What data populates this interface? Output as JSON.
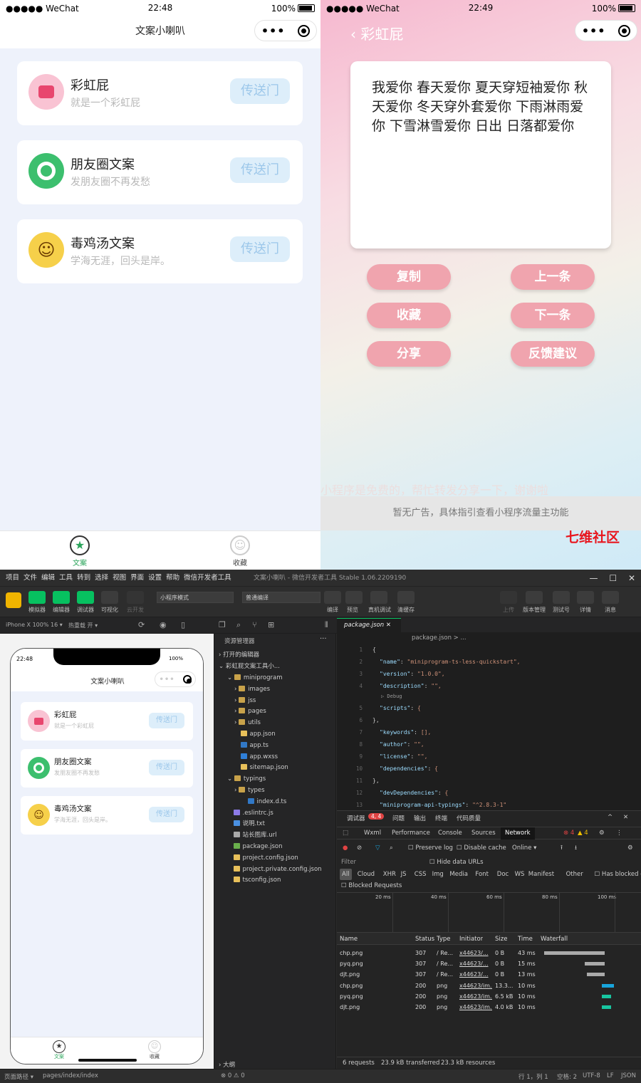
{
  "left_phone": {
    "status": {
      "carrier": "●●●●● WeChat",
      "time": "22:48",
      "battery": "100%"
    },
    "nav_title": "文案小喇叭",
    "cards": [
      {
        "title": "彩虹屁",
        "subtitle": "就是一个彩虹屁",
        "button": "传送门",
        "icon": "heart-icon",
        "color": "#f7a8c0"
      },
      {
        "title": "朋友圈文案",
        "subtitle": "发朋友圈不再发愁",
        "button": "传送门",
        "icon": "shutter-icon",
        "color": "#3cbf6e"
      },
      {
        "title": "毒鸡汤文案",
        "subtitle": "学海无涯，回头是岸。",
        "button": "传送门",
        "icon": "emoji-face-icon",
        "color": "#f6d04a"
      }
    ],
    "tabs": [
      {
        "label": "文案",
        "icon": "star-icon"
      },
      {
        "label": "收藏",
        "icon": "user-icon"
      }
    ]
  },
  "right_phone": {
    "status": {
      "carrier": "●●●●● WeChat",
      "time": "22:49",
      "battery": "100%"
    },
    "back_title": "彩虹屁",
    "content_text": "我爱你 春天爱你 夏天穿短袖爱你 秋天爱你 冬天穿外套爱你 下雨淋雨爱你 下雪淋雪爱你 日出 日落都爱你",
    "buttons": {
      "copy": "复制",
      "prev": "上一条",
      "collect": "收藏",
      "next": "下一条",
      "share": "分享",
      "feedback": "反馈建议"
    },
    "share_note": "小程序是免费的，帮忙转发分享一下，谢谢啦",
    "ad_text": "暂无广告，具体指引查看小程序流量主功能",
    "watermark": "七维社区"
  },
  "ide": {
    "menu": [
      "项目",
      "文件",
      "编辑",
      "工具",
      "转到",
      "选择",
      "视图",
      "界面",
      "设置",
      "帮助",
      "微信开发者工具"
    ],
    "window_title": "文案小喇叭 - 微信开发者工具 Stable 1.06.2209190",
    "toolbar_left": [
      "模拟器",
      "编辑器",
      "调试器",
      "可视化",
      "云开发"
    ],
    "mode_select": "小程序模式",
    "compile_select": "普通编译",
    "toolbar_mid": [
      "编译",
      "预览",
      "真机调试",
      "清缓存"
    ],
    "toolbar_right": [
      "上传",
      "版本管理",
      "测试号",
      "详情",
      "消息"
    ],
    "device": "iPhone X 100% 16 ▾",
    "hot_reload": "热重载 开 ▾",
    "sim": {
      "time": "22:48",
      "battery": "100%",
      "title": "文案小喇叭",
      "cards": [
        {
          "title": "彩虹屁",
          "subtitle": "就是一个彩虹屁",
          "button": "传送门"
        },
        {
          "title": "朋友圈文案",
          "subtitle": "发朋友圈不再发愁",
          "button": "传送门"
        },
        {
          "title": "毒鸡汤文案",
          "subtitle": "学海无涯，回头是岸。",
          "button": "传送门"
        }
      ],
      "tabs": [
        "文案",
        "收藏"
      ]
    },
    "explorer": {
      "title": "资源管理器",
      "open_editors": "打开的编辑器",
      "project": "彩虹屁文案工具小...",
      "tree": [
        {
          "name": "miniprogram",
          "type": "folder-open",
          "indent": 1
        },
        {
          "name": "images",
          "type": "folder",
          "indent": 2
        },
        {
          "name": "jss",
          "type": "folder",
          "indent": 2
        },
        {
          "name": "pages",
          "type": "folder",
          "indent": 2
        },
        {
          "name": "utils",
          "type": "folder",
          "indent": 2
        },
        {
          "name": "app.json",
          "type": "json",
          "indent": 2
        },
        {
          "name": "app.ts",
          "type": "ts",
          "indent": 2
        },
        {
          "name": "app.wxss",
          "type": "wxss",
          "indent": 2
        },
        {
          "name": "sitemap.json",
          "type": "json",
          "indent": 2
        },
        {
          "name": "typings",
          "type": "folder-open",
          "indent": 1
        },
        {
          "name": "types",
          "type": "folder",
          "indent": 2
        },
        {
          "name": "index.d.ts",
          "type": "ts",
          "indent": 3
        },
        {
          "name": ".eslintrc.js",
          "type": "js",
          "indent": 1
        },
        {
          "name": "说明.txt",
          "type": "txt",
          "indent": 1
        },
        {
          "name": "站长图库.url",
          "type": "url",
          "indent": 1
        },
        {
          "name": "package.json",
          "type": "pkg",
          "indent": 1
        },
        {
          "name": "project.config.json",
          "type": "json",
          "indent": 1
        },
        {
          "name": "project.private.config.json",
          "type": "json",
          "indent": 1
        },
        {
          "name": "tsconfig.json",
          "type": "json",
          "indent": 1
        }
      ],
      "outline": "大纲"
    },
    "editor": {
      "tab": "package.json",
      "breadcrumb": "package.json > ...",
      "debug_hint": "▷ Debug",
      "lines": [
        {
          "n": "1",
          "text": "{"
        },
        {
          "n": "2",
          "key": "\"name\"",
          "val": "\"miniprogram-ts-less-quickstart\","
        },
        {
          "n": "3",
          "key": "\"version\"",
          "val": "\"1.0.0\","
        },
        {
          "n": "4",
          "key": "\"description\"",
          "val": "\"\","
        },
        {
          "n": "5",
          "key": "\"scripts\"",
          "val": "{"
        },
        {
          "n": "6",
          "text": "},"
        },
        {
          "n": "7",
          "key": "\"keywords\"",
          "val": "[],"
        },
        {
          "n": "8",
          "key": "\"author\"",
          "val": "\"\","
        },
        {
          "n": "9",
          "key": "\"license\"",
          "val": "\"\","
        },
        {
          "n": "10",
          "key": "\"dependencies\"",
          "val": "{"
        },
        {
          "n": "11",
          "text": "},"
        },
        {
          "n": "12",
          "key": "\"devDependencies\"",
          "val": "{"
        },
        {
          "n": "13",
          "key": "\"miniprogram-api-typings\"",
          "val": "\"^2.8.3-1\""
        }
      ]
    },
    "devtools": {
      "title": "调试器",
      "badge": "4, 4",
      "top_tabs": [
        "问题",
        "输出",
        "终端",
        "代码质量"
      ],
      "panels": [
        "Wxml",
        "Performance",
        "Console",
        "Sources",
        "Network"
      ],
      "active_panel": "Network",
      "errors": "4",
      "warnings": "4",
      "options": [
        "Preserve log",
        "Disable cache",
        "Online"
      ],
      "filter": "Filter",
      "hide_data_urls": "Hide data URLs",
      "types": [
        "All",
        "Cloud",
        "XHR",
        "JS",
        "CSS",
        "Img",
        "Media",
        "Font",
        "Doc",
        "WS",
        "Manifest",
        "Other"
      ],
      "blocked_cookies": "Has blocked cookies",
      "blocked_requests": "Blocked Requests",
      "timeline_ticks": [
        "20 ms",
        "40 ms",
        "60 ms",
        "80 ms",
        "100 ms"
      ],
      "columns": [
        "Name",
        "Status",
        "Type",
        "Initiator",
        "Size",
        "Time",
        "Waterfall"
      ],
      "rows": [
        {
          "name": "chp.png",
          "status": "307",
          "type": "/ Re...",
          "initiator": "x44623/...",
          "size": "0 B",
          "time": "43 ms",
          "color": "#aaaaaa",
          "bar_start": 0.05,
          "bar_len": 0.9
        },
        {
          "name": "pyq.png",
          "status": "307",
          "type": "/ Re...",
          "initiator": "x44623/...",
          "size": "0 B",
          "time": "15 ms",
          "color": "#aaaaaa",
          "bar_start": 0.65,
          "bar_len": 0.3
        },
        {
          "name": "djt.png",
          "status": "307",
          "type": "/ Re...",
          "initiator": "x44623/...",
          "size": "0 B",
          "time": "13 ms",
          "color": "#aaaaaa",
          "bar_start": 0.68,
          "bar_len": 0.27
        },
        {
          "name": "chp.png",
          "status": "200",
          "type": "png",
          "initiator": "x44623/im...",
          "size": "13.3...",
          "time": "10 ms",
          "color": "#18a5dc",
          "bar_start": 0.9,
          "bar_len": 0.18
        },
        {
          "name": "pyq.png",
          "status": "200",
          "type": "png",
          "initiator": "x44623/im...",
          "size": "6.5 kB",
          "time": "10 ms",
          "color": "#18c5a0",
          "bar_start": 0.9,
          "bar_len": 0.14
        },
        {
          "name": "djt.png",
          "status": "200",
          "type": "png",
          "initiator": "x44623/im...",
          "size": "4.0 kB",
          "time": "10 ms",
          "color": "#18c5a0",
          "bar_start": 0.9,
          "bar_len": 0.14
        }
      ],
      "summary": [
        "6 requests",
        "23.9 kB transferred",
        "23.3 kB resources"
      ]
    },
    "statusbar": {
      "path_label": "页面路径 ▾",
      "path": "pages/index/index",
      "problems": "⊗ 0 ⚠ 0",
      "cursor": "行 1，列 1",
      "spaces": "空格: 2",
      "encoding": "UTF-8",
      "eol": "LF",
      "lang": "JSON"
    }
  }
}
